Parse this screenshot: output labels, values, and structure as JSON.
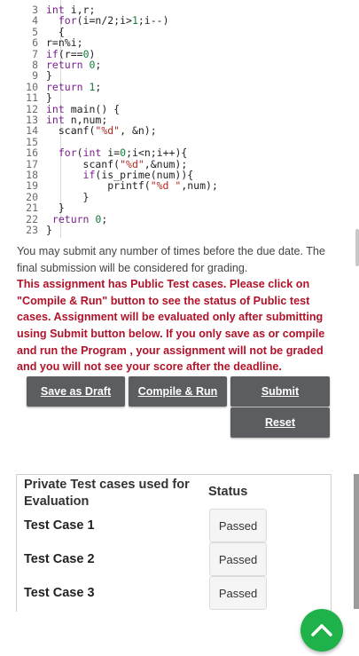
{
  "code": {
    "lines": [
      {
        "n": "3",
        "parts": [
          {
            "t": "int",
            "c": "kw"
          },
          {
            "t": " i,r;",
            "c": ""
          }
        ]
      },
      {
        "n": "4",
        "parts": [
          {
            "t": "  for",
            "c": "kw"
          },
          {
            "t": "(i=n/2;i>",
            "c": ""
          },
          {
            "t": "1",
            "c": "num"
          },
          {
            "t": ";i--)",
            "c": ""
          }
        ]
      },
      {
        "n": "5",
        "parts": [
          {
            "t": "  {",
            "c": ""
          }
        ]
      },
      {
        "n": "6",
        "parts": [
          {
            "t": "r=n%i;",
            "c": ""
          }
        ]
      },
      {
        "n": "7",
        "parts": [
          {
            "t": "if",
            "c": "kw"
          },
          {
            "t": "(r==",
            "c": ""
          },
          {
            "t": "0",
            "c": "num"
          },
          {
            "t": ")",
            "c": ""
          }
        ]
      },
      {
        "n": "8",
        "parts": [
          {
            "t": "return",
            "c": "kw"
          },
          {
            "t": " ",
            "c": ""
          },
          {
            "t": "0",
            "c": "num"
          },
          {
            "t": ";",
            "c": ""
          }
        ]
      },
      {
        "n": "9",
        "parts": [
          {
            "t": "}",
            "c": ""
          }
        ]
      },
      {
        "n": "10",
        "parts": [
          {
            "t": "return",
            "c": "kw"
          },
          {
            "t": " ",
            "c": ""
          },
          {
            "t": "1",
            "c": "num"
          },
          {
            "t": ";",
            "c": ""
          }
        ]
      },
      {
        "n": "11",
        "parts": [
          {
            "t": "}",
            "c": ""
          }
        ]
      },
      {
        "n": "12",
        "parts": [
          {
            "t": "int",
            "c": "kw"
          },
          {
            "t": " main() {",
            "c": ""
          }
        ]
      },
      {
        "n": "13",
        "parts": [
          {
            "t": "int",
            "c": "kw"
          },
          {
            "t": " n,num;",
            "c": ""
          }
        ]
      },
      {
        "n": "14",
        "parts": [
          {
            "t": "  scanf(",
            "c": ""
          },
          {
            "t": "\"%d\"",
            "c": "str"
          },
          {
            "t": ", &n);",
            "c": ""
          }
        ]
      },
      {
        "n": "15",
        "parts": []
      },
      {
        "n": "16",
        "parts": [
          {
            "t": "  for",
            "c": "kw"
          },
          {
            "t": "(",
            "c": ""
          },
          {
            "t": "int",
            "c": "kw"
          },
          {
            "t": " i=",
            "c": ""
          },
          {
            "t": "0",
            "c": "num"
          },
          {
            "t": ";i<n;i++){",
            "c": ""
          }
        ]
      },
      {
        "n": "17",
        "parts": [
          {
            "t": "      scanf(",
            "c": ""
          },
          {
            "t": "\"%d\"",
            "c": "str"
          },
          {
            "t": ",&num);",
            "c": ""
          }
        ]
      },
      {
        "n": "18",
        "parts": [
          {
            "t": "      if",
            "c": "kw"
          },
          {
            "t": "(is_prime(num)){",
            "c": ""
          }
        ]
      },
      {
        "n": "19",
        "parts": [
          {
            "t": "          printf(",
            "c": ""
          },
          {
            "t": "\"%d \"",
            "c": "str"
          },
          {
            "t": ",num);",
            "c": ""
          }
        ]
      },
      {
        "n": "20",
        "parts": [
          {
            "t": "      }",
            "c": ""
          }
        ]
      },
      {
        "n": "21",
        "parts": [
          {
            "t": "  }",
            "c": ""
          }
        ]
      },
      {
        "n": "22",
        "parts": [
          {
            "t": " return",
            "c": "kw"
          },
          {
            "t": " ",
            "c": ""
          },
          {
            "t": "0",
            "c": "num"
          },
          {
            "t": ";",
            "c": ""
          }
        ]
      },
      {
        "n": "23",
        "parts": [
          {
            "t": "}",
            "c": ""
          }
        ]
      }
    ]
  },
  "info": {
    "normal": "You may submit any number of times before the due date. The final submission will be considered for grading.",
    "warning": "This assignment has Public Test cases. Please click on \"Compile & Run\" button to see the status of Public test cases. Assignment will be evaluated only after submitting using Submit button below. If you only save as or compile and run the Program , your assignment will not be graded and you will not see your score after the deadline."
  },
  "buttons": {
    "save_draft": "Save as Draft",
    "compile_run": "Compile & Run",
    "submit": "Submit",
    "reset": "Reset"
  },
  "private_tests": {
    "header": "Private Test cases used for Evaluation",
    "status_header": "Status",
    "rows": [
      {
        "label": "Test Case 1",
        "status": "Passed"
      },
      {
        "label": "Test Case 2",
        "status": "Passed"
      },
      {
        "label": "Test Case 3",
        "status": "Passed"
      }
    ]
  },
  "colors": {
    "keyword": "#7a1f8f",
    "number": "#127d3a",
    "string": "#b3261e",
    "warning": "#b0132a",
    "button": "#5b5d60",
    "fab": "#20b24a"
  },
  "icons": {
    "fab": "chevron-up-icon"
  }
}
